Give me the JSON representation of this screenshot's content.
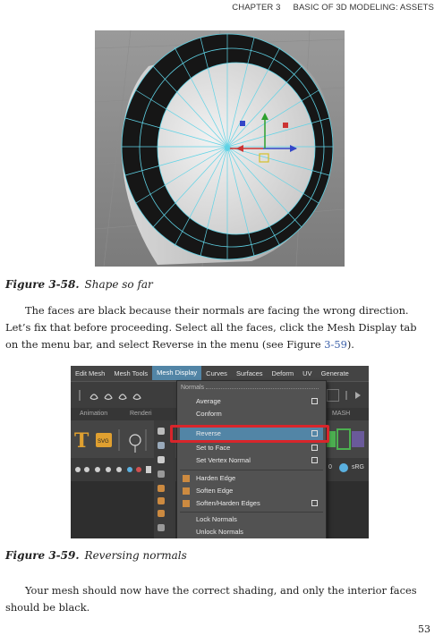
{
  "header": {
    "chapter": "CHAPTER 3",
    "title": "BASIC OF 3D MODELING: ASSETS"
  },
  "figure1": {
    "label": "Figure 3-58.",
    "caption": "Shape so far"
  },
  "paragraph1": {
    "text_before": "The faces are black because their normals are facing the wrong direction. Let’s fix that before proceeding. Select all the faces, click the Mesh Display tab on the menu bar, and select Reverse in the menu (see Figure ",
    "ref": "3-59",
    "text_after": ")."
  },
  "figure2": {
    "label": "Figure 3-59.",
    "caption": "Reversing normals",
    "menubar": [
      "Edit Mesh",
      "Mesh Tools",
      "Mesh Display",
      "Curves",
      "Surfaces",
      "Deform",
      "UV",
      "Generate"
    ],
    "active_menu": "Mesh Display",
    "tabs": {
      "animation": "Animation",
      "rendering": "Renderi",
      "mash": "MASH"
    },
    "status_text": "sRG",
    "dropdown": {
      "header": "Normals",
      "items": [
        {
          "label": "Average",
          "options": true
        },
        {
          "label": "Conform",
          "options": false
        },
        {
          "label": "Reverse",
          "options": true,
          "highlighted": true
        },
        {
          "label": "Set to Face",
          "options": true
        },
        {
          "label": "Set Vertex Normal",
          "options": true
        },
        {
          "label": "Harden Edge",
          "options": false
        },
        {
          "label": "Soften Edge",
          "options": false
        },
        {
          "label": "Soften/Harden Edges",
          "options": true
        },
        {
          "label": "Lock Normals",
          "options": false
        },
        {
          "label": "Unlock Normals",
          "options": false
        }
      ]
    },
    "accent_color": "#5285a6",
    "highlight_border_color": "#d8252b"
  },
  "paragraph2": {
    "text": "Your mesh should now have the correct shading, and only the interior faces should be black."
  },
  "page_number": "53"
}
